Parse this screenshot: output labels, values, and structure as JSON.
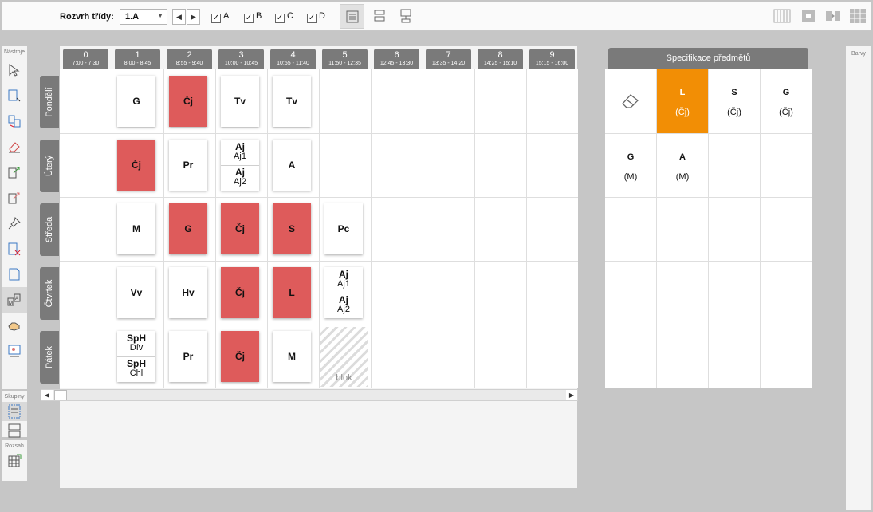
{
  "toolbar": {
    "class_label": "Rozvrh třídy:",
    "class_value": "1.A",
    "groups": [
      {
        "label": "A",
        "checked": true
      },
      {
        "label": "B",
        "checked": true
      },
      {
        "label": "C",
        "checked": true
      },
      {
        "label": "D",
        "checked": true
      }
    ]
  },
  "tools": {
    "section_tools": "Nástroje",
    "section_groups": "Skupiny",
    "section_range": "Rozsah"
  },
  "periods": [
    {
      "num": "0",
      "time": "7:00 - 7:30"
    },
    {
      "num": "1",
      "time": "8:00 - 8:45"
    },
    {
      "num": "2",
      "time": "8:55 - 9:40"
    },
    {
      "num": "3",
      "time": "10:00 - 10:45"
    },
    {
      "num": "4",
      "time": "10:55 - 11:40"
    },
    {
      "num": "5",
      "time": "11:50 - 12:35"
    },
    {
      "num": "6",
      "time": "12:45 - 13:30"
    },
    {
      "num": "7",
      "time": "13:35 - 14:20"
    },
    {
      "num": "8",
      "time": "14:25 - 15:10"
    },
    {
      "num": "9",
      "time": "15:15 - 16:00"
    }
  ],
  "days": [
    "Pondělí",
    "Úterý",
    "Středa",
    "Čtvrtek",
    "Pátek"
  ],
  "lessons": {
    "mon1": "G",
    "mon2": "Čj",
    "mon3": "Tv",
    "mon4": "Tv",
    "tue1": "Čj",
    "tue2": "Pr",
    "tue3a_subj": "Aj",
    "tue3a_grp": "Aj1",
    "tue3b_subj": "Aj",
    "tue3b_grp": "Aj2",
    "tue4": "A",
    "wed1": "M",
    "wed2": "G",
    "wed3": "Čj",
    "wed4": "S",
    "wed5": "Pc",
    "thu1": "Vv",
    "thu2": "Hv",
    "thu3": "Čj",
    "thu4": "L",
    "thu5a_subj": "Aj",
    "thu5a_grp": "Aj1",
    "thu5b_subj": "Aj",
    "thu5b_grp": "Aj2",
    "fri1a_subj": "SpH",
    "fri1a_grp": "Dív",
    "fri1b_subj": "SpH",
    "fri1b_grp": "Chl",
    "fri2": "Pr",
    "fri3": "Čj",
    "fri4": "M",
    "blok": "blok"
  },
  "colors": {
    "conflict": "#de5b5b",
    "selected": "#f28e05",
    "header": "#7a7a7a"
  },
  "spec": {
    "title": "Specifikace předmětů",
    "items": [
      {
        "subj": "L",
        "group": "(Čj)"
      },
      {
        "subj": "S",
        "group": "(Čj)"
      },
      {
        "subj": "G",
        "group": "(Čj)"
      },
      {
        "subj": "G",
        "group": "(M)"
      },
      {
        "subj": "A",
        "group": "(M)"
      }
    ]
  },
  "barvy": "Barvy"
}
